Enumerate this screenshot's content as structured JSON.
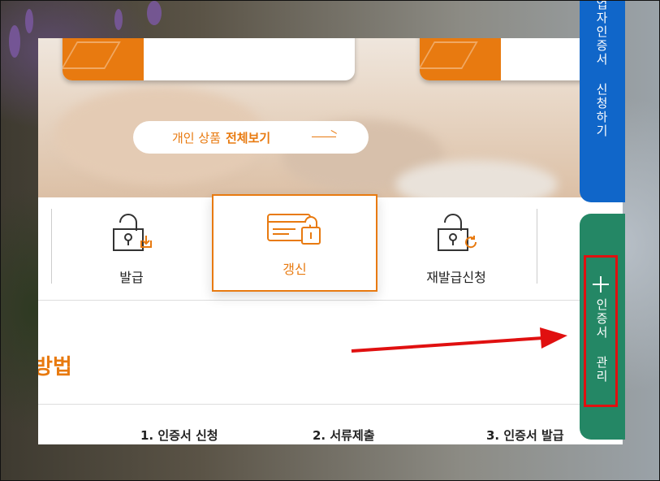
{
  "hero": {
    "view_all_prefix": "개인 상품",
    "view_all_bold": "전체보기"
  },
  "menu": {
    "items": [
      {
        "label": "발급",
        "icon": "lock-download-icon",
        "active": false
      },
      {
        "label": "갱신",
        "icon": "card-lock-icon",
        "active": true
      },
      {
        "label": "재발급신청",
        "icon": "lock-refresh-icon",
        "active": false
      }
    ]
  },
  "section": {
    "heading": "방법",
    "steps": [
      "1. 인증서 신청",
      "2. 서류제출",
      "3. 인증서 발급"
    ]
  },
  "side_tabs": {
    "business": "업자인증서 신청하기",
    "manage": "인증서 관리"
  },
  "colors": {
    "accent": "#e87a10",
    "blue_tab": "#1066c9",
    "green_tab": "#248765",
    "highlight": "#e01010"
  }
}
